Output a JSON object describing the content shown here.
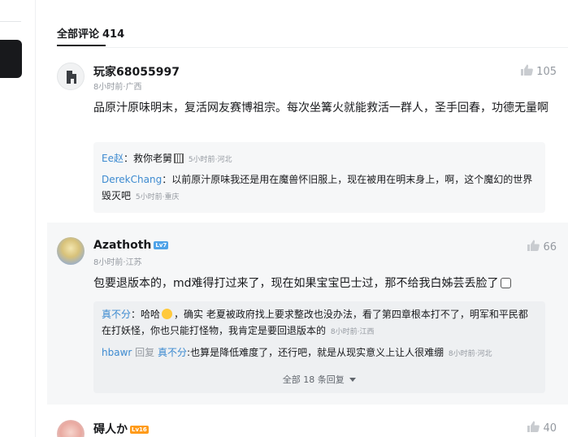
{
  "header": {
    "title": "全部评论",
    "count": "414"
  },
  "comments": [
    {
      "username": "玩家68055997",
      "time": "8小时前",
      "location": "广西",
      "likes": "105",
      "content": "品原汁原味明末，复活网友赛博祖宗。每次坐篝火就能救活一群人，圣手回春，功德无量啊",
      "replies": [
        {
          "name": "Ee赵",
          "sep": "：",
          "text": "救你老舅",
          "time": "5小时前",
          "location": "河北"
        },
        {
          "name": "DerekChang",
          "sep": "：",
          "text": "以前原汁原味我还是用在魔兽怀旧服上，现在被用在明末身上，啊，这个魔幻的世界毁灭吧",
          "time": "5小时前",
          "location": "重庆"
        }
      ]
    },
    {
      "username": "Azathoth",
      "level": "Lv7",
      "time": "8小时前",
      "location": "江苏",
      "likes": "66",
      "content": "包要退版本的，md难得打过来了，现在如果宝宝巴士过，那不给我白姊芸丢脸了",
      "replies": [
        {
          "name": "真不分",
          "sep": "：",
          "text_a": "哈哈",
          "text_b": "，确实 老夏被政府找上要求整改也没办法，看了第四章根本打不了，明军和平民都在打妖怪，你也只能打怪物，我肯定是要回退版本的",
          "time": "8小时前",
          "location": "江西"
        },
        {
          "name": "hbawr",
          "reply_word": "回复",
          "target": "真不分",
          "sep": ":",
          "text": "也算是降低难度了，还行吧，就是从现实意义上让人很难绷",
          "time": "8小时前",
          "location": "河北"
        }
      ],
      "more_label": "全部 18 条回复"
    },
    {
      "username": "碍人か",
      "level": "Lv16",
      "likes": "40"
    }
  ],
  "colors": {
    "link": "#3c8ad0",
    "muted": "#9499a0",
    "lv7": "#4fa3e8",
    "lv16": "#ff9b1a"
  }
}
